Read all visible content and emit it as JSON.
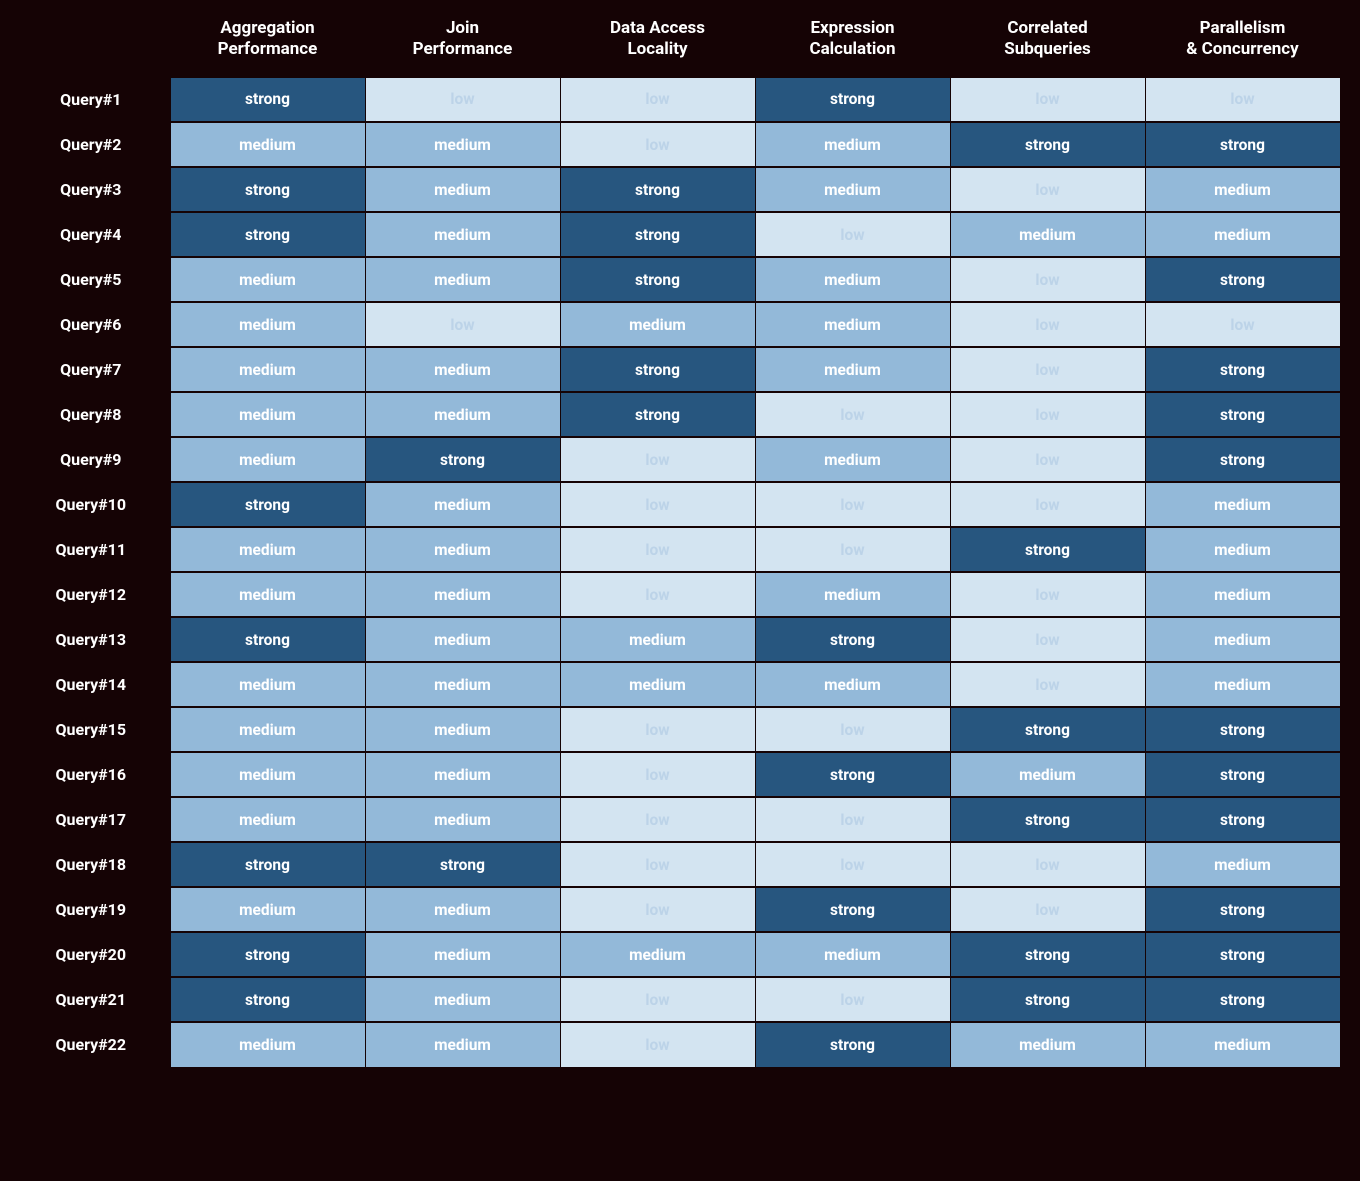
{
  "chart_data": {
    "type": "heatmap",
    "title": "",
    "levels": [
      "low",
      "medium",
      "strong"
    ],
    "level_colors": {
      "low": "#d3e4f1",
      "medium": "#93b9d9",
      "strong": "#27567f"
    },
    "columns": [
      "Aggregation\nPerformance",
      "Join\nPerformance",
      "Data Access\nLocality",
      "Expression\nCalculation",
      "Correlated\nSubqueries",
      "Parallelism\n& Concurrency"
    ],
    "rows": [
      "Query#1",
      "Query#2",
      "Query#3",
      "Query#4",
      "Query#5",
      "Query#6",
      "Query#7",
      "Query#8",
      "Query#9",
      "Query#10",
      "Query#11",
      "Query#12",
      "Query#13",
      "Query#14",
      "Query#15",
      "Query#16",
      "Query#17",
      "Query#18",
      "Query#19",
      "Query#20",
      "Query#21",
      "Query#22"
    ],
    "values": [
      [
        "strong",
        "low",
        "low",
        "strong",
        "low",
        "low"
      ],
      [
        "medium",
        "medium",
        "low",
        "medium",
        "strong",
        "strong"
      ],
      [
        "strong",
        "medium",
        "strong",
        "medium",
        "low",
        "medium"
      ],
      [
        "strong",
        "medium",
        "strong",
        "low",
        "medium",
        "medium"
      ],
      [
        "medium",
        "medium",
        "strong",
        "medium",
        "low",
        "strong"
      ],
      [
        "medium",
        "low",
        "medium",
        "medium",
        "low",
        "low"
      ],
      [
        "medium",
        "medium",
        "strong",
        "medium",
        "low",
        "strong"
      ],
      [
        "medium",
        "medium",
        "strong",
        "low",
        "low",
        "strong"
      ],
      [
        "medium",
        "strong",
        "low",
        "medium",
        "low",
        "strong"
      ],
      [
        "strong",
        "medium",
        "low",
        "low",
        "low",
        "medium"
      ],
      [
        "medium",
        "medium",
        "low",
        "low",
        "strong",
        "medium"
      ],
      [
        "medium",
        "medium",
        "low",
        "medium",
        "low",
        "medium"
      ],
      [
        "strong",
        "medium",
        "medium",
        "strong",
        "low",
        "medium"
      ],
      [
        "medium",
        "medium",
        "medium",
        "medium",
        "low",
        "medium"
      ],
      [
        "medium",
        "medium",
        "low",
        "low",
        "strong",
        "strong"
      ],
      [
        "medium",
        "medium",
        "low",
        "strong",
        "medium",
        "strong"
      ],
      [
        "medium",
        "medium",
        "low",
        "low",
        "strong",
        "strong"
      ],
      [
        "strong",
        "strong",
        "low",
        "low",
        "low",
        "medium"
      ],
      [
        "medium",
        "medium",
        "low",
        "strong",
        "low",
        "strong"
      ],
      [
        "strong",
        "medium",
        "medium",
        "medium",
        "strong",
        "strong"
      ],
      [
        "strong",
        "medium",
        "low",
        "low",
        "strong",
        "strong"
      ],
      [
        "medium",
        "medium",
        "low",
        "strong",
        "medium",
        "medium"
      ]
    ]
  }
}
